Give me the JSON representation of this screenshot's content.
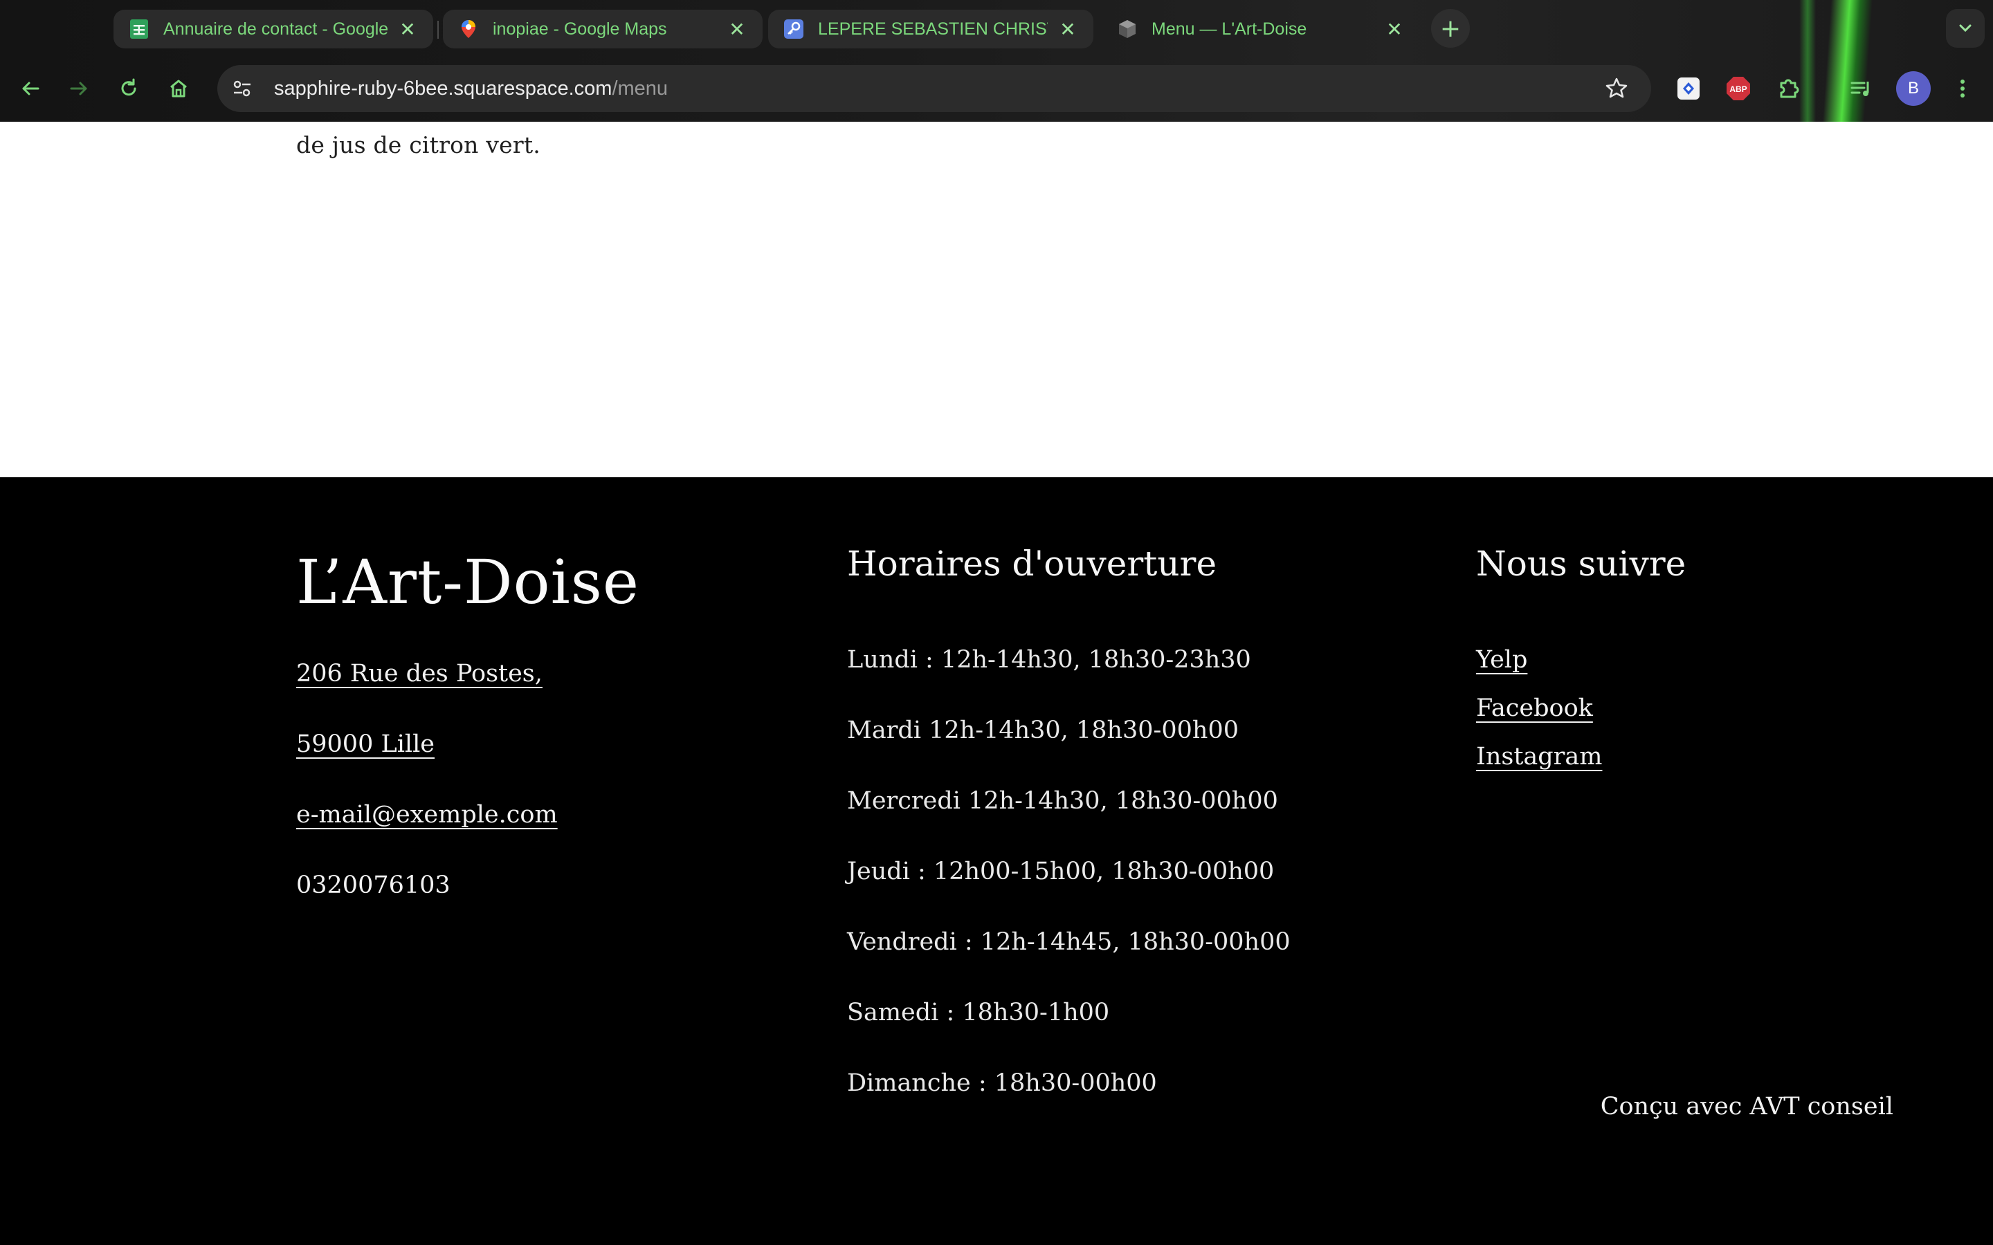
{
  "browser": {
    "tabs": [
      {
        "title": "Annuaire de contact - Google Sheets",
        "icon": "sheets-icon",
        "active": false
      },
      {
        "title": "inopiae - Google Maps",
        "icon": "maps-pin-icon",
        "active": false
      },
      {
        "title": "LEPERE SEBASTIEN CHRISTIAN",
        "icon": "key-icon",
        "active": false
      },
      {
        "title": "Menu — L'Art-Doise",
        "icon": "cube-icon",
        "active": true
      }
    ],
    "url_host": "sapphire-ruby-6bee.squarespace.com",
    "url_path": "/menu",
    "profile_initial": "B",
    "accent_color": "#7cd87c"
  },
  "page": {
    "menu_tail_text": "de jus de citron vert."
  },
  "footer": {
    "brand": "L’Art-Doise",
    "contact": {
      "street": "206 Rue des Postes,",
      "city": "59000 Lille",
      "email": "e-mail@exemple.com",
      "phone": "0320076103"
    },
    "hours_title": "Horaires d'ouverture",
    "hours": [
      "Lundi : 12h-14h30, 18h30-23h30",
      "Mardi 12h-14h30, 18h30-00h00",
      "Mercredi 12h-14h30, 18h30-00h00",
      "Jeudi : 12h00-15h00, 18h30-00h00",
      "Vendredi : 12h-14h45, 18h30-00h00",
      "Samedi : 18h30-1h00",
      "Dimanche : 18h30-00h00"
    ],
    "follow_title": "Nous suivre",
    "social": [
      "Yelp",
      "Facebook",
      "Instagram"
    ],
    "credit": "Conçu avec AVT conseil"
  }
}
